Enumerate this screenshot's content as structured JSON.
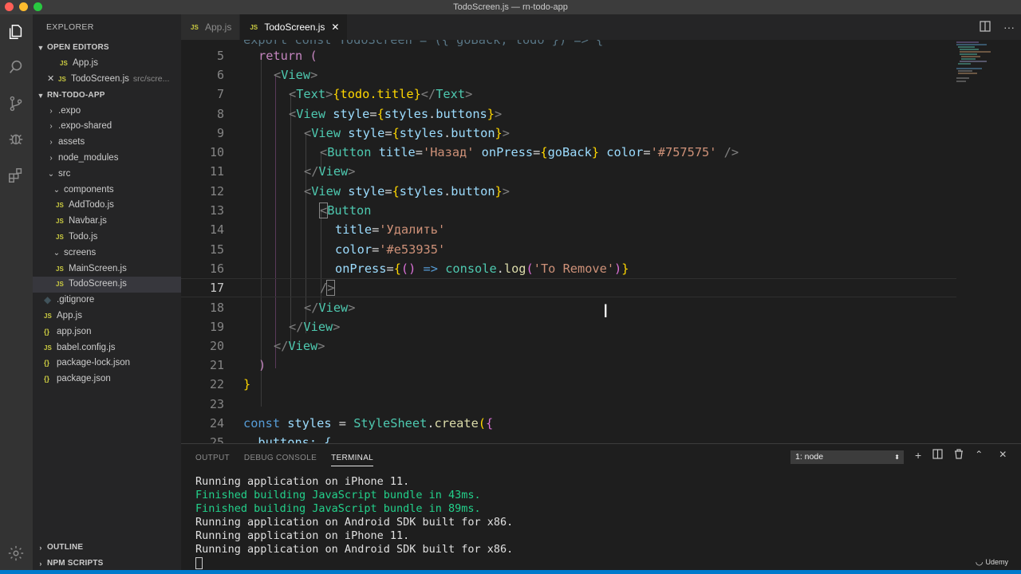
{
  "window": {
    "title": "TodoScreen.js — rn-todo-app"
  },
  "sidebar": {
    "header": "EXPLORER",
    "open_editors_label": "OPEN EDITORS",
    "open_editors": [
      {
        "badge": "JS",
        "name": "App.js",
        "path": ""
      },
      {
        "badge": "JS",
        "name": "TodoScreen.js",
        "path": "src/scre..."
      }
    ],
    "project_label": "RN-TODO-APP",
    "tree": [
      {
        "type": "folder",
        "name": ".expo",
        "open": false
      },
      {
        "type": "folder",
        "name": ".expo-shared",
        "open": false
      },
      {
        "type": "folder",
        "name": "assets",
        "open": false
      },
      {
        "type": "folder",
        "name": "node_modules",
        "open": false
      },
      {
        "type": "folder",
        "name": "src",
        "open": true
      },
      {
        "type": "folder",
        "name": "components",
        "open": true
      },
      {
        "type": "file",
        "badge": "JS",
        "name": "AddTodo.js"
      },
      {
        "type": "file",
        "badge": "JS",
        "name": "Navbar.js"
      },
      {
        "type": "file",
        "badge": "JS",
        "name": "Todo.js"
      },
      {
        "type": "folder",
        "name": "screens",
        "open": true
      },
      {
        "type": "file",
        "badge": "JS",
        "name": "MainScreen.js"
      },
      {
        "type": "file",
        "badge": "JS",
        "name": "TodoScreen.js"
      },
      {
        "type": "file",
        "badge": "◆",
        "name": ".gitignore"
      },
      {
        "type": "file",
        "badge": "JS",
        "name": "App.js"
      },
      {
        "type": "file",
        "badge": "{}",
        "name": "app.json"
      },
      {
        "type": "file",
        "badge": "JS",
        "name": "babel.config.js"
      },
      {
        "type": "file",
        "badge": "{}",
        "name": "package-lock.json"
      },
      {
        "type": "file",
        "badge": "{}",
        "name": "package.json"
      }
    ],
    "outline_label": "OUTLINE",
    "npm_label": "NPM SCRIPTS"
  },
  "tabs": [
    {
      "badge": "JS",
      "label": "App.js"
    },
    {
      "badge": "JS",
      "label": "TodoScreen.js"
    }
  ],
  "editor": {
    "partial_top": "export const TodoScreen = ({ goBack, todo }) => {",
    "line_numbers": [
      "5",
      "6",
      "7",
      "8",
      "9",
      "10",
      "11",
      "12",
      "13",
      "14",
      "15",
      "16",
      "17",
      "18",
      "19",
      "20",
      "21",
      "22",
      "23",
      "24",
      "25"
    ],
    "current_line": "17",
    "lines": {
      "l5_kw": "return",
      "l5_paren": " (",
      "l7_text": "{todo.title}",
      "l10_title_val": "'Назад'",
      "l10_color_val": "'#757575'",
      "l14_title_val": "'Удалить'",
      "l15_color_val": "'#e53935'",
      "l16_str": "'To Remove'",
      "l24_name": "styles",
      "l24_fn": "StyleSheet",
      "l24_method": "create",
      "l25_partial": "  buttons: {"
    }
  },
  "panel": {
    "tabs": [
      "OUTPUT",
      "DEBUG CONSOLE",
      "TERMINAL"
    ],
    "active_tab": "TERMINAL",
    "terminal_select": "1: node",
    "terminal_lines": [
      {
        "text": "Running application on iPhone 11.",
        "color": "#e0e0e0"
      },
      {
        "text": "Finished building JavaScript bundle in 43ms.",
        "color": "#23d18b"
      },
      {
        "text": "Finished building JavaScript bundle in 89ms.",
        "color": "#23d18b"
      },
      {
        "text": "Running application on Android SDK built for x86.",
        "color": "#e0e0e0"
      },
      {
        "text": "Running application on iPhone 11.",
        "color": "#e0e0e0"
      },
      {
        "text": "Running application on Android SDK built for x86.",
        "color": "#e0e0e0"
      }
    ]
  },
  "watermark": "Udemy",
  "colors": {
    "accent": "#007acc",
    "js_badge": "#cbcb41",
    "terminal_green": "#23d18b"
  }
}
